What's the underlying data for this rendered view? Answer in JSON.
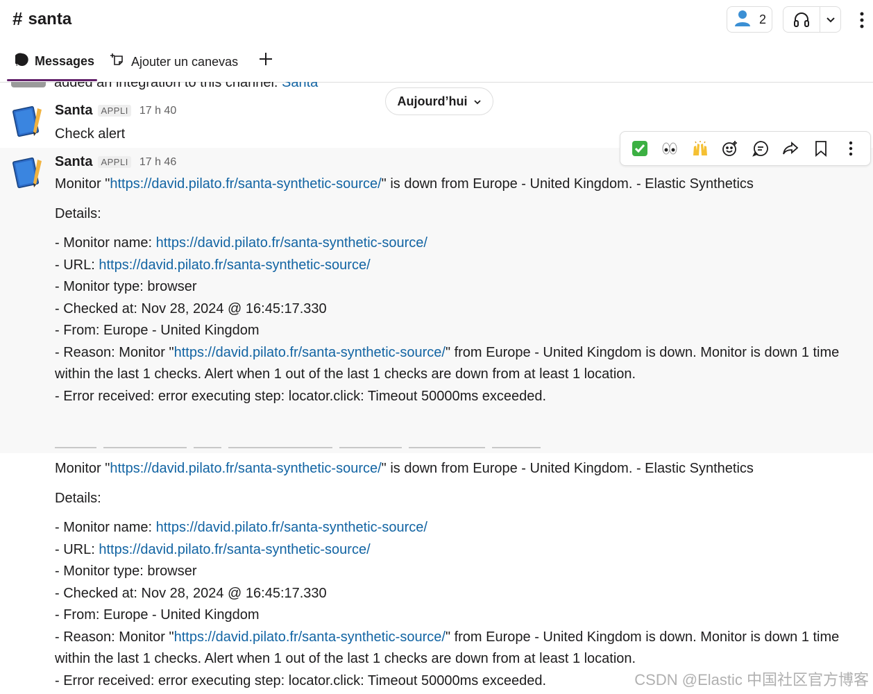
{
  "header": {
    "channel_name": "santa",
    "member_count": "2"
  },
  "tabs": [
    {
      "label": "Messages"
    },
    {
      "label": "Ajouter un canevas"
    }
  ],
  "previous_message": {
    "text": "added an integration to this channel: ",
    "link": "Santa"
  },
  "date_divider": "Aujourd’hui",
  "messages": [
    {
      "author": "Santa",
      "badge": "APPLI",
      "time": "17 h 40",
      "text": "Check alert"
    },
    {
      "author": "Santa",
      "badge": "APPLI",
      "time": "17 h 46",
      "monitor_prefix": "Monitor \"",
      "monitor_link": "https://david.pilato.fr/santa-synthetic-source/",
      "monitor_suffix": "\" is down from Europe - United Kingdom. - Elastic Synthetics",
      "details_label": "Details:",
      "monitor_name_label": "- Monitor name: ",
      "monitor_name_link": "https://david.pilato.fr/santa-synthetic-source/",
      "url_label": "- URL: ",
      "url_link": "https://david.pilato.fr/santa-synthetic-source/",
      "monitor_type": "- Monitor type: browser",
      "checked_at": "- Checked at: Nov 28, 2024 @ 16:45:17.330",
      "from": "- From: Europe - United Kingdom",
      "reason_prefix": "- Reason: Monitor \"",
      "reason_link": "https://david.pilato.fr/santa-synthetic-source/",
      "reason_suffix": "\" from Europe - United Kingdom is down. Monitor is down 1 time within the last 1 checks. Alert when 1 out of the last 1 checks are down from at least 1 location.",
      "error": "- Error received: error executing step: locator.click: Timeout 50000ms exceeded."
    },
    {
      "monitor_prefix": "Monitor \"",
      "monitor_link": "https://david.pilato.fr/santa-synthetic-source/",
      "monitor_suffix": "\" is down from Europe - United Kingdom. - Elastic Synthetics",
      "details_label": "Details:",
      "monitor_name_label": "- Monitor name: ",
      "monitor_name_link": "https://david.pilato.fr/santa-synthetic-source/",
      "url_label": "- URL: ",
      "url_link": "https://david.pilato.fr/santa-synthetic-source/",
      "monitor_type": "- Monitor type: browser",
      "checked_at": "- Checked at: Nov 28, 2024 @ 16:45:17.330",
      "from": "- From: Europe - United Kingdom",
      "reason_prefix": "- Reason: Monitor \"",
      "reason_link": "https://david.pilato.fr/santa-synthetic-source/",
      "reason_suffix": "\" from Europe - United Kingdom is down. Monitor is down 1 time within the last 1 checks. Alert when 1 out of the last 1 checks are down from at least 1 location.",
      "error": "- Error received: error executing step: locator.click: Timeout 50000ms exceeded."
    }
  ],
  "hover_toolbar": {
    "icons": [
      "check-mark-emoji",
      "eyes-emoji",
      "raised-hands-emoji",
      "add-reaction-icon",
      "reply-thread-icon",
      "forward-icon",
      "bookmark-icon",
      "more-actions-icon"
    ]
  },
  "watermark": "CSDN @Elastic 中国社区官方博客",
  "colors": {
    "link": "#1264a3",
    "tab_underline": "#611f69",
    "hover_bg": "#f8f8f8"
  }
}
